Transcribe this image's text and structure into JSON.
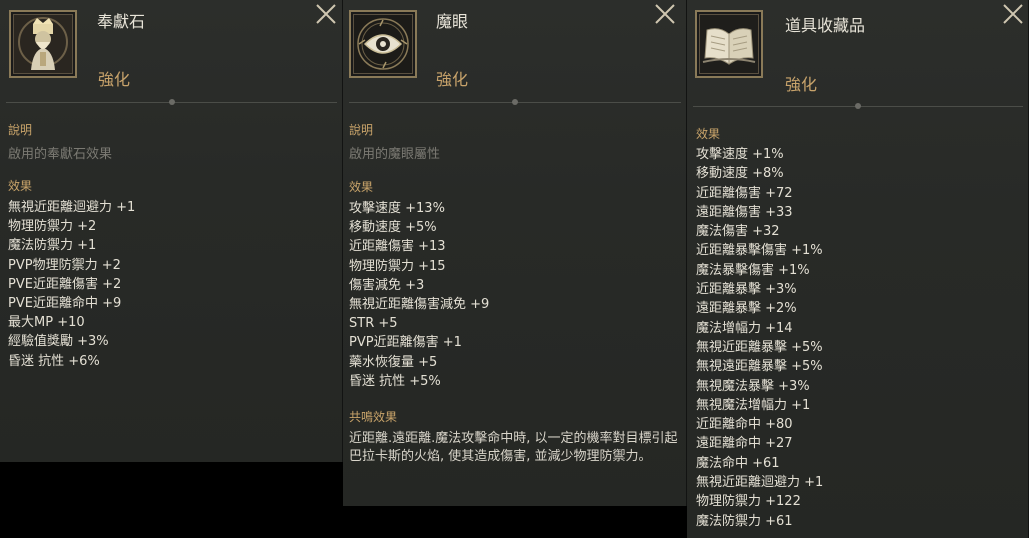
{
  "panels": [
    {
      "title": "奉獻石",
      "enhance_label": "強化",
      "description_label": "說明",
      "description_text": "啟用的奉獻石效果",
      "effects_label": "效果",
      "effects": [
        "無視近距離迴避力 +1",
        "物理防禦力 +2",
        "魔法防禦力 +1",
        "PVP物理防禦力 +2",
        "PVE近距離傷害 +2",
        "PVE近距離命中 +9",
        "最大MP +10",
        "經驗值獎勵 +3%",
        "昏迷 抗性 +6%"
      ],
      "icon": "priest-portrait-icon"
    },
    {
      "title": "魔眼",
      "enhance_label": "強化",
      "description_label": "說明",
      "description_text": "啟用的魔眼屬性",
      "effects_label": "效果",
      "effects": [
        "攻擊速度 +13%",
        "移動速度 +5%",
        "近距離傷害 +13",
        "物理防禦力 +15",
        "傷害減免 +3",
        "無視近距離傷害減免 +9",
        "STR +5",
        "PVP近距離傷害 +1",
        "藥水恢復量 +5",
        "昏迷 抗性 +5%"
      ],
      "resonance_label": "共鳴效果",
      "resonance_text": "近距離.遠距離.魔法攻擊命中時, 以一定的機率對目標引起巴拉卡斯的火焰, 使其造成傷害, 並減少物理防禦力。",
      "icon": "magic-eye-icon"
    },
    {
      "title": "道具收藏品",
      "enhance_label": "強化",
      "effects_label": "效果",
      "effects": [
        "攻擊速度 +1%",
        "移動速度 +8%",
        "近距離傷害 +72",
        "遠距離傷害 +33",
        "魔法傷害 +32",
        "近距離暴擊傷害 +1%",
        "魔法暴擊傷害 +1%",
        "近距離暴擊 +3%",
        "遠距離暴擊 +2%",
        "魔法增幅力 +14",
        "無視近距離暴擊 +5%",
        "無視遠距離暴擊 +5%",
        "無視魔法暴擊 +3%",
        "無視魔法增幅力 +1",
        "近距離命中 +80",
        "遠距離命中 +27",
        "魔法命中 +61",
        "無視近距離迴避力 +1",
        "物理防禦力 +122",
        "魔法防禦力 +61"
      ],
      "icon": "open-book-icon"
    }
  ],
  "colors": {
    "panel_bg": "#2a2c29",
    "title": "#e8e4d8",
    "accent_gold": "#c8a36b",
    "text": "#e4e0d4",
    "muted": "#7b7a73"
  }
}
